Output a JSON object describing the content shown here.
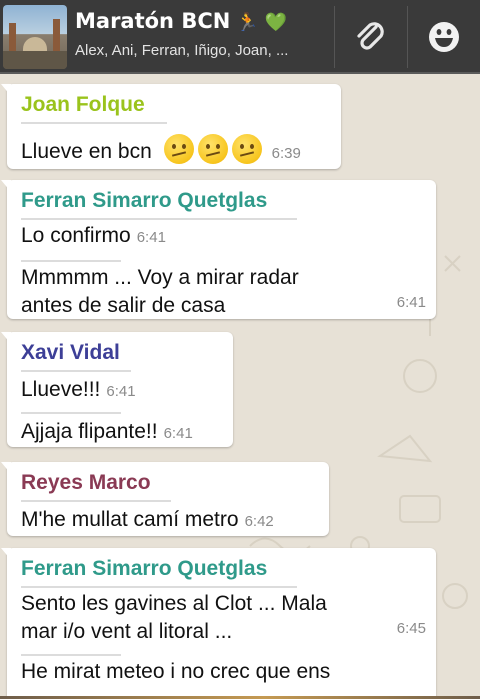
{
  "header": {
    "title": "Maratón BCN",
    "title_emoji_runner": "🏃",
    "title_emoji_heart": "💚",
    "members": "Alex, Ani, Ferran, Iñigo, Joan, ...",
    "background": "#3a3a3a"
  },
  "icons": {
    "attach": "paperclip-icon",
    "emoji": "smiley-icon",
    "avatar": "group-avatar-image",
    "face": "confused-face-emoji"
  },
  "messages": [
    {
      "sender": "Joan Folque",
      "sender_color": "#9ac31c",
      "lines": [
        {
          "text": "Llueve en bcn",
          "emoji_count": 3,
          "time": "6:39"
        }
      ]
    },
    {
      "sender": "Ferran Simarro Quetglas",
      "sender_color": "#2f9a8a",
      "lines": [
        {
          "text": "Lo confirmo",
          "time": "6:41"
        },
        {
          "text_1": "Mmmmm ... Voy a mirar radar",
          "text_2": "antes de salir de casa",
          "time": "6:41"
        }
      ]
    },
    {
      "sender": "Xavi Vidal",
      "sender_color": "#3d3f97",
      "lines": [
        {
          "text": "Llueve!!!",
          "time": "6:41"
        },
        {
          "text": "Ajjaja flipante!!",
          "time": "6:41"
        }
      ]
    },
    {
      "sender": "Reyes Marco",
      "sender_color": "#8a3a54",
      "lines": [
        {
          "text": "M'he mullat camí metro",
          "time": "6:42"
        }
      ]
    },
    {
      "sender": "Ferran Simarro Quetglas",
      "sender_color": "#2f9a8a",
      "lines": [
        {
          "text_1": "Sento les gavines al Clot ... Mala",
          "text_2": "mar i/o vent al litoral ...",
          "time": "6:45"
        },
        {
          "text": "He mirat meteo i no crec que ens"
        }
      ]
    }
  ]
}
